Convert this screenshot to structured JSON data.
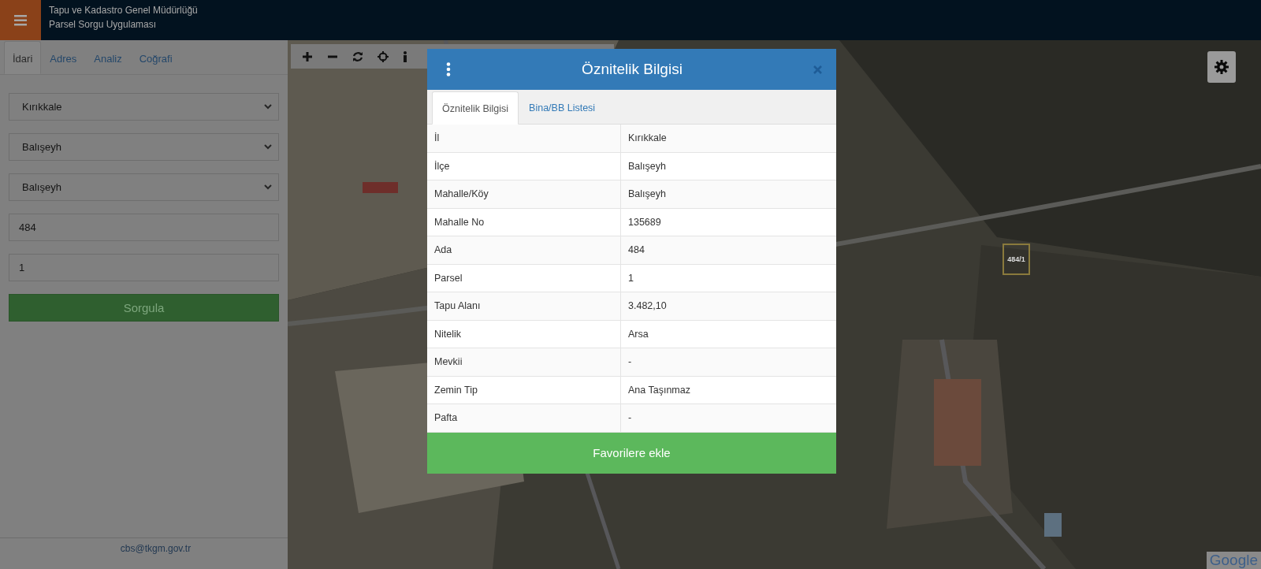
{
  "header": {
    "title": "Tapu ve Kadastro Genel Müdürlüğü",
    "subtitle": "Parsel Sorgu Uygulaması"
  },
  "sidebar": {
    "tabs": [
      {
        "label": "İdari",
        "selected": true
      },
      {
        "label": "Adres",
        "selected": false
      },
      {
        "label": "Analiz",
        "selected": false
      },
      {
        "label": "Coğrafi",
        "selected": false
      }
    ],
    "fields": [
      {
        "kind": "select",
        "value": "Kırıkkale"
      },
      {
        "kind": "select",
        "value": "Balışeyh"
      },
      {
        "kind": "select",
        "value": "Balışeyh"
      },
      {
        "kind": "text",
        "value": "484"
      },
      {
        "kind": "text",
        "value": "1"
      }
    ],
    "submit": "Sorgula",
    "footer": "cbs@tkgm.gov.tr"
  },
  "map": {
    "parcel_label": "484/1",
    "attribution": "Google"
  },
  "modal": {
    "title": "Öznitelik Bilgisi",
    "tabs": [
      {
        "label": "Öznitelik Bilgisi",
        "selected": true
      },
      {
        "label": "Bina/BB Listesi",
        "selected": false
      }
    ],
    "rows": [
      {
        "key": "İl",
        "value": "Kırıkkale"
      },
      {
        "key": "İlçe",
        "value": "Balışeyh"
      },
      {
        "key": "Mahalle/Köy",
        "value": "Balışeyh"
      },
      {
        "key": "Mahalle No",
        "value": "135689"
      },
      {
        "key": "Ada",
        "value": "484"
      },
      {
        "key": "Parsel",
        "value": "1"
      },
      {
        "key": "Tapu Alanı",
        "value": "3.482,10"
      },
      {
        "key": "Nitelik",
        "value": "Arsa"
      },
      {
        "key": "Mevkii",
        "value": "-"
      },
      {
        "key": "Zemin Tip",
        "value": "Ana Taşınmaz"
      },
      {
        "key": "Pafta",
        "value": "-"
      }
    ],
    "action": "Favorilere ekle"
  }
}
